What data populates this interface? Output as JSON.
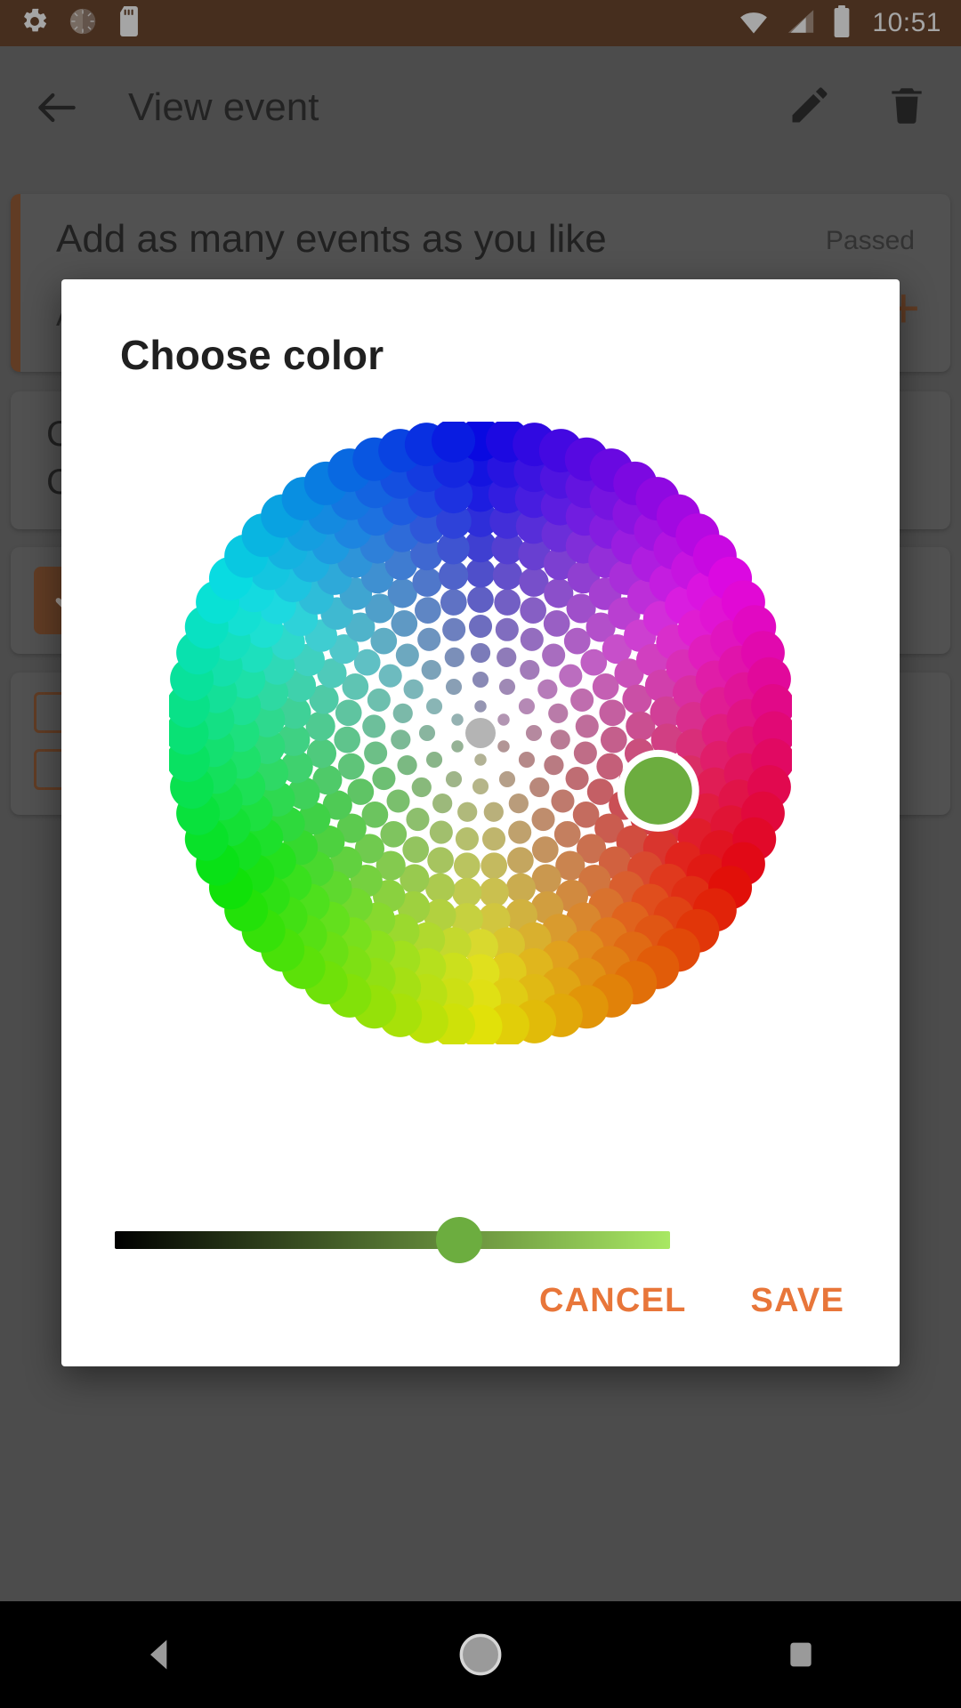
{
  "status_bar": {
    "time": "10:51",
    "background": "#5C3317",
    "icons": [
      "settings-gear-icon",
      "brightness-dial-icon",
      "sd-card-icon",
      "wifi-icon",
      "cell-signal-icon",
      "battery-icon"
    ]
  },
  "app_bar": {
    "title": "View event",
    "back_label": "back-arrow-icon",
    "edit_label": "edit-pencil-icon",
    "delete_label": "delete-trash-icon"
  },
  "background": {
    "event_card": {
      "title": "Add as many events as you like",
      "status": "Passed",
      "subtitle": "A",
      "accent": "#8a4a22"
    },
    "description_card": {
      "line1": "C",
      "line2": "C"
    },
    "done_card": {
      "chip": "check-icon"
    },
    "extra_card": {
      "chip1": "",
      "chip2": ""
    }
  },
  "dialog": {
    "title": "Choose color",
    "cancel_label": "CANCEL",
    "save_label": "SAVE",
    "accent_color": "#E8763A",
    "selected_color": "#6CAD3F",
    "brightness": {
      "value": 62,
      "min": 0,
      "max": 100,
      "from_color": "#000000",
      "to_color": "#A8E863",
      "thumb_color": "#6CAD3F"
    },
    "color_wheel": {
      "center_color": "#B4B4B4",
      "rings": 11,
      "selected_ring": 7,
      "selected_angle_deg": 108,
      "hue_start_deg": 0,
      "description": "radial hue/saturation dot wheel"
    }
  },
  "nav_bar": {
    "back": "nav-back-triangle-icon",
    "home": "nav-home-circle-icon",
    "recents": "nav-recents-square-icon"
  }
}
